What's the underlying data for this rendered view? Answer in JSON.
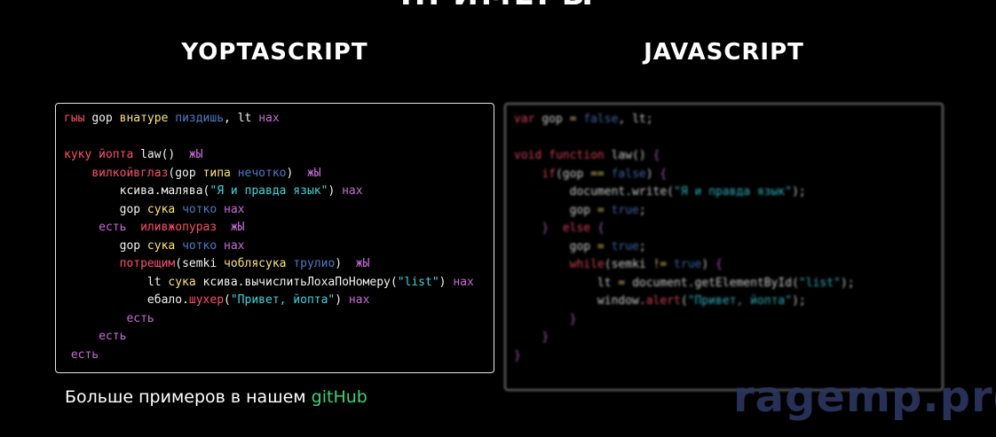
{
  "section": {
    "title": "ПРИМЕРЫ"
  },
  "columns": {
    "left": {
      "title": "YOPTASCRIPT"
    },
    "right": {
      "title": "JAVASCRIPT"
    }
  },
  "yopta_code": [
    [
      {
        "t": "гыы ",
        "c": "kw"
      },
      {
        "t": "gop ",
        "c": "plain"
      },
      {
        "t": "внатуре ",
        "c": "yellow"
      },
      {
        "t": "пиздишь",
        "c": "blue"
      },
      {
        "t": ", lt ",
        "c": "plain"
      },
      {
        "t": "нах",
        "c": "purple"
      }
    ],
    [],
    [
      {
        "t": "куку ",
        "c": "kw"
      },
      {
        "t": "йопта ",
        "c": "kw"
      },
      {
        "t": "law()  ",
        "c": "plain"
      },
      {
        "t": "жЫ",
        "c": "purple"
      }
    ],
    [
      {
        "t": "    ",
        "c": "plain"
      },
      {
        "t": "вилкойвглаз",
        "c": "kw"
      },
      {
        "t": "(gop ",
        "c": "plain"
      },
      {
        "t": "типа ",
        "c": "yellow"
      },
      {
        "t": "нечотко",
        "c": "blue"
      },
      {
        "t": ")  ",
        "c": "plain"
      },
      {
        "t": "жЫ",
        "c": "purple"
      }
    ],
    [
      {
        "t": "        ксива.малява(",
        "c": "plain"
      },
      {
        "t": "\"Я и правда язык\"",
        "c": "str"
      },
      {
        "t": ") ",
        "c": "plain"
      },
      {
        "t": "нах",
        "c": "purple"
      }
    ],
    [
      {
        "t": "        gop ",
        "c": "plain"
      },
      {
        "t": "сука ",
        "c": "yellow"
      },
      {
        "t": "чотко ",
        "c": "blue"
      },
      {
        "t": "нах",
        "c": "purple"
      }
    ],
    [
      {
        "t": "     ",
        "c": "plain"
      },
      {
        "t": "есть  ",
        "c": "purple"
      },
      {
        "t": "иливжопураз  ",
        "c": "kw"
      },
      {
        "t": "жЫ",
        "c": "purple"
      }
    ],
    [
      {
        "t": "        gop ",
        "c": "plain"
      },
      {
        "t": "сука ",
        "c": "yellow"
      },
      {
        "t": "чотко ",
        "c": "blue"
      },
      {
        "t": "нах",
        "c": "purple"
      }
    ],
    [
      {
        "t": "        ",
        "c": "plain"
      },
      {
        "t": "потрещим",
        "c": "kw"
      },
      {
        "t": "(semki ",
        "c": "plain"
      },
      {
        "t": "чоблясука ",
        "c": "yellow"
      },
      {
        "t": "трулио",
        "c": "blue"
      },
      {
        "t": ")  ",
        "c": "plain"
      },
      {
        "t": "жЫ",
        "c": "purple"
      }
    ],
    [
      {
        "t": "            lt ",
        "c": "plain"
      },
      {
        "t": "сука ",
        "c": "yellow"
      },
      {
        "t": "ксива.вычислитьЛохаПоНомеру(",
        "c": "plain"
      },
      {
        "t": "\"list\"",
        "c": "str"
      },
      {
        "t": ") ",
        "c": "plain"
      },
      {
        "t": "нах",
        "c": "purple"
      }
    ],
    [
      {
        "t": "            ебало.",
        "c": "plain"
      },
      {
        "t": "шухер",
        "c": "kw"
      },
      {
        "t": "(",
        "c": "plain"
      },
      {
        "t": "\"Привет, йопта\"",
        "c": "str"
      },
      {
        "t": ") ",
        "c": "plain"
      },
      {
        "t": "нах",
        "c": "purple"
      }
    ],
    [
      {
        "t": "         ",
        "c": "plain"
      },
      {
        "t": "есть",
        "c": "purple"
      }
    ],
    [
      {
        "t": "     ",
        "c": "plain"
      },
      {
        "t": "есть",
        "c": "purple"
      }
    ],
    [
      {
        "t": " ",
        "c": "plain"
      },
      {
        "t": "есть",
        "c": "purple"
      }
    ]
  ],
  "js_code": [
    [
      {
        "t": "var ",
        "c": "kw"
      },
      {
        "t": "gop ",
        "c": "plain"
      },
      {
        "t": "= ",
        "c": "yellow"
      },
      {
        "t": "false",
        "c": "blue"
      },
      {
        "t": ", lt;",
        "c": "plain"
      }
    ],
    [],
    [
      {
        "t": "void ",
        "c": "kw"
      },
      {
        "t": "function ",
        "c": "kw"
      },
      {
        "t": "law() ",
        "c": "plain"
      },
      {
        "t": "{",
        "c": "purple"
      }
    ],
    [
      {
        "t": "    ",
        "c": "plain"
      },
      {
        "t": "if",
        "c": "kw"
      },
      {
        "t": "(gop ",
        "c": "plain"
      },
      {
        "t": "== ",
        "c": "yellow"
      },
      {
        "t": "false",
        "c": "blue"
      },
      {
        "t": ") ",
        "c": "plain"
      },
      {
        "t": "{",
        "c": "purple"
      }
    ],
    [
      {
        "t": "        document.write(",
        "c": "plain"
      },
      {
        "t": "\"Я и правда язык\"",
        "c": "str"
      },
      {
        "t": ");",
        "c": "plain"
      }
    ],
    [
      {
        "t": "        gop ",
        "c": "plain"
      },
      {
        "t": "= ",
        "c": "yellow"
      },
      {
        "t": "true",
        "c": "blue"
      },
      {
        "t": ";",
        "c": "plain"
      }
    ],
    [
      {
        "t": "    ",
        "c": "plain"
      },
      {
        "t": "}  ",
        "c": "purple"
      },
      {
        "t": "else ",
        "c": "kw"
      },
      {
        "t": "{",
        "c": "purple"
      }
    ],
    [
      {
        "t": "        gop ",
        "c": "plain"
      },
      {
        "t": "= ",
        "c": "yellow"
      },
      {
        "t": "true",
        "c": "blue"
      },
      {
        "t": ";",
        "c": "plain"
      }
    ],
    [
      {
        "t": "        ",
        "c": "plain"
      },
      {
        "t": "while",
        "c": "kw"
      },
      {
        "t": "(semki ",
        "c": "plain"
      },
      {
        "t": "!= ",
        "c": "yellow"
      },
      {
        "t": "true",
        "c": "blue"
      },
      {
        "t": ") ",
        "c": "plain"
      },
      {
        "t": "{",
        "c": "purple"
      }
    ],
    [
      {
        "t": "            lt ",
        "c": "plain"
      },
      {
        "t": "= ",
        "c": "yellow"
      },
      {
        "t": "document.getElementById(",
        "c": "plain"
      },
      {
        "t": "\"list\"",
        "c": "str"
      },
      {
        "t": ");",
        "c": "plain"
      }
    ],
    [
      {
        "t": "            window.",
        "c": "plain"
      },
      {
        "t": "alert",
        "c": "kw"
      },
      {
        "t": "(",
        "c": "plain"
      },
      {
        "t": "\"Привет, йопта\"",
        "c": "str"
      },
      {
        "t": ");",
        "c": "plain"
      }
    ],
    [
      {
        "t": "        ",
        "c": "plain"
      },
      {
        "t": "}",
        "c": "purple"
      }
    ],
    [
      {
        "t": "    ",
        "c": "plain"
      },
      {
        "t": "}",
        "c": "purple"
      }
    ],
    [
      {
        "t": "}",
        "c": "purple"
      }
    ]
  ],
  "footer": {
    "text": "Больше примеров в нашем ",
    "link": "gitHub"
  },
  "watermark": {
    "text": "ragemp.pro"
  },
  "colors": {
    "background": "#000000",
    "keyword": "#ff4d6d",
    "operator": "#ffe36e",
    "boolean": "#4b7bc7",
    "bracket": "#c76bd9",
    "string": "#39d5e0",
    "link": "#39d27a",
    "watermark": "#2b355f"
  }
}
